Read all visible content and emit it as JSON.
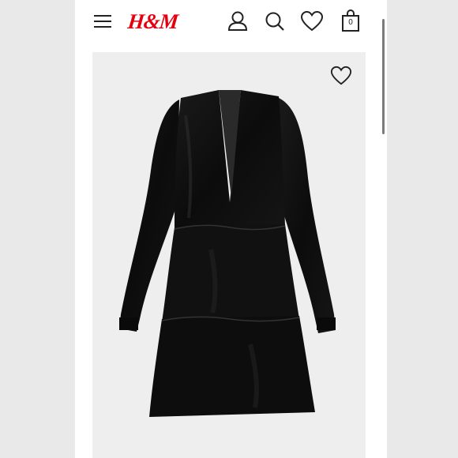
{
  "header": {
    "logo_text": "H&M",
    "icons": {
      "menu": "hamburger-menu-icon",
      "account": "user-icon",
      "search": "search-icon",
      "favorites": "heart-icon",
      "bag": "shopping-bag-icon"
    },
    "bag_count": "0"
  },
  "product": {
    "image": "black-velvet-tiered-dress",
    "favorite_icon": "heart-icon"
  },
  "colors": {
    "brand_red": "#e50010",
    "icon_color": "#222222",
    "card_background": "#eeeeee"
  }
}
